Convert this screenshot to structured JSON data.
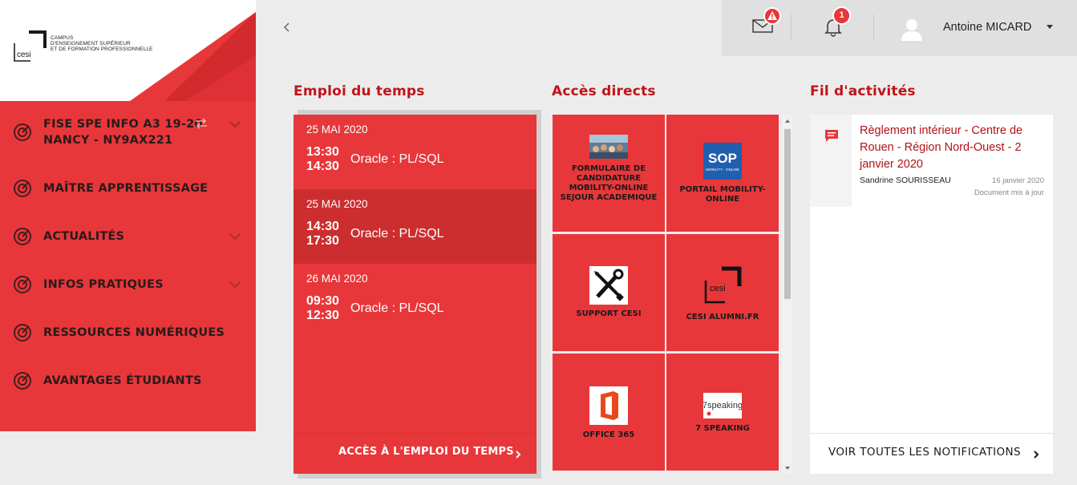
{
  "brand": {
    "logo_mark": "cesi",
    "logo_lines": [
      "CAMPUS",
      "D'ENSEIGNEMENT SUPÉRIEUR",
      "ET DE FORMATION PROFESSIONNELLE"
    ],
    "accent_color": "#e8373a",
    "title_color": "#c0141a"
  },
  "sidebar": {
    "items": [
      {
        "label_line1": "FISE SPE INFO A3 19-20",
        "label_line2": "NANCY - NY9AX221",
        "icon": "target-icon",
        "has_switch": true,
        "has_chevron": true
      },
      {
        "label": "MAÎTRE APPRENTISSAGE",
        "icon": "target-icon",
        "has_chevron": false
      },
      {
        "label": "ACTUALITÉS",
        "icon": "target-icon",
        "has_chevron": true
      },
      {
        "label": "INFOS PRATIQUES",
        "icon": "target-icon",
        "has_chevron": true
      },
      {
        "label": "RESSOURCES NUMÉRIQUES",
        "icon": "target-icon",
        "has_chevron": false
      },
      {
        "label": "AVANTAGES ÉTUDIANTS",
        "icon": "target-icon",
        "has_chevron": false
      }
    ]
  },
  "header": {
    "back_icon": "chevron-left-icon",
    "mail_icon": "envelope-icon",
    "mail_badge_icon": "warning-icon",
    "bell_icon": "bell-icon",
    "bell_badge": "1",
    "user_name": "Antoine MICARD"
  },
  "schedule": {
    "title": "Emploi du temps",
    "events": [
      {
        "date": "25 MAI 2020",
        "start": "13:30",
        "end": "14:30",
        "course": "Oracle : PL/SQL",
        "active": false
      },
      {
        "date": "25 MAI 2020",
        "start": "14:30",
        "end": "17:30",
        "course": "Oracle : PL/SQL",
        "active": true
      },
      {
        "date": "26 MAI 2020",
        "start": "09:30",
        "end": "12:30",
        "course": "Oracle : PL/SQL",
        "active": false
      }
    ],
    "footer_link": "ACCÈS À L'EMPLOI DU TEMPS"
  },
  "quick_access": {
    "title": "Accès directs",
    "tiles": [
      {
        "label": "FORMULAIRE DE CANDIDATURE MOBILITY-ONLINE SEJOUR ACADEMIQUE",
        "icon": "crowd-photo-icon"
      },
      {
        "label": "PORTAIL MOBILITY-ONLINE",
        "icon": "sop-logo-icon",
        "logo_text": "SOP",
        "logo_sub": "MOBILITY - ONLINE"
      },
      {
        "label": "SUPPORT CESI",
        "icon": "tools-icon"
      },
      {
        "label": "CESI ALUMNI.FR",
        "icon": "cesi-logo-icon",
        "logo_text": "cesi"
      },
      {
        "label": "OFFICE 365",
        "icon": "office-icon"
      },
      {
        "label": "7 SPEAKING",
        "icon": "7speaking-logo-icon",
        "logo_text": "7speaking"
      }
    ]
  },
  "activity": {
    "title": "Fil d'activités",
    "items": [
      {
        "title": "Règlement intérieur - Centre de Rouen - Région Nord-Ouest - 2 janvier 2020",
        "author": "Sandrine SOURISSEAU",
        "date": "16 janvier 2020",
        "status": "Document mis à jour",
        "icon": "comment-icon"
      }
    ],
    "footer_link": "VOIR TOUTES LES NOTIFICATIONS"
  }
}
